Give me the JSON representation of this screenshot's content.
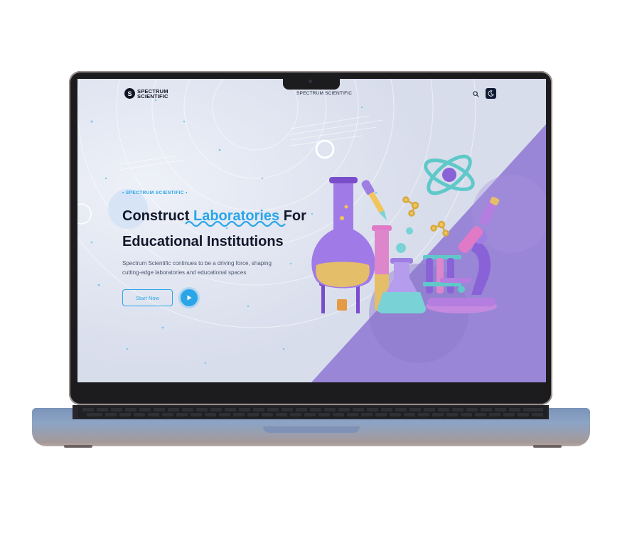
{
  "header": {
    "logo_line1": "SPECTRUM",
    "logo_line2": "SCIENTIFIC",
    "logo_mark": "S",
    "nav_title": "SPECTRUM SCIENTIFIC",
    "icons": [
      "search-icon",
      "moon-icon"
    ]
  },
  "hero": {
    "eyebrow": "• SPECTRUM SCIENTIFIC •",
    "headline_part1": "Construct ",
    "headline_accent": "Laboratories",
    "headline_part2": " For",
    "headline_line2": "Educational Institutions",
    "description": "Spectrum Scientific continues to be a driving force, shaping cutting-edge laboratories and educational spaces",
    "start_button": "Start Now",
    "play_icon": "play-icon"
  },
  "colors": {
    "accent": "#2aa6e8",
    "purple": "#9a86d6",
    "background": "#dde2f0",
    "dark": "#11182b"
  }
}
